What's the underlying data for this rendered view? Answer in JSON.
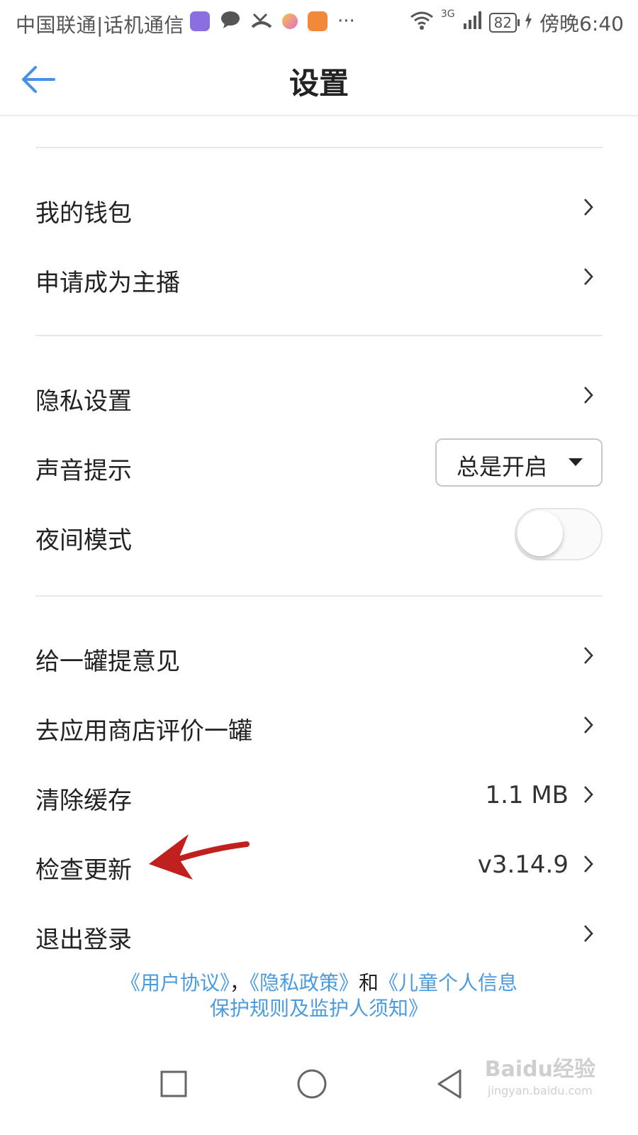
{
  "status_bar": {
    "carrier": "中国联通|话机通信",
    "battery": "82",
    "time": "傍晚6:40",
    "network": "3G",
    "more": "···"
  },
  "header": {
    "title": "设置"
  },
  "sections": {
    "account": [
      {
        "label": "我的钱包"
      },
      {
        "label": "申请成为主播"
      }
    ],
    "preferences": {
      "privacy": {
        "label": "隐私设置"
      },
      "sound": {
        "label": "声音提示",
        "selected": "总是开启"
      },
      "night": {
        "label": "夜间模式",
        "enabled": false
      }
    },
    "misc": {
      "feedback": {
        "label": "给一罐提意见"
      },
      "rate": {
        "label": "去应用商店评价一罐"
      },
      "cache": {
        "label": "清除缓存",
        "value": "1.1 MB"
      },
      "update": {
        "label": "检查更新",
        "value": "v3.14.9"
      },
      "logout": {
        "label": "退出登录"
      }
    }
  },
  "footer": {
    "user_agreement": "《用户协议》",
    "comma": "，",
    "privacy_policy": "《隐私政策》",
    "and": "和",
    "children_rules_line1": "《儿童个人信息",
    "children_rules_line2": "保护规则及监护人须知》"
  },
  "watermark": {
    "top": "Baidu经验",
    "bottom": "jingyan.baidu.com"
  },
  "colors": {
    "link": "#4a9be0",
    "accent_back": "#4a90e2",
    "annotation_arrow": "#c0201e"
  }
}
